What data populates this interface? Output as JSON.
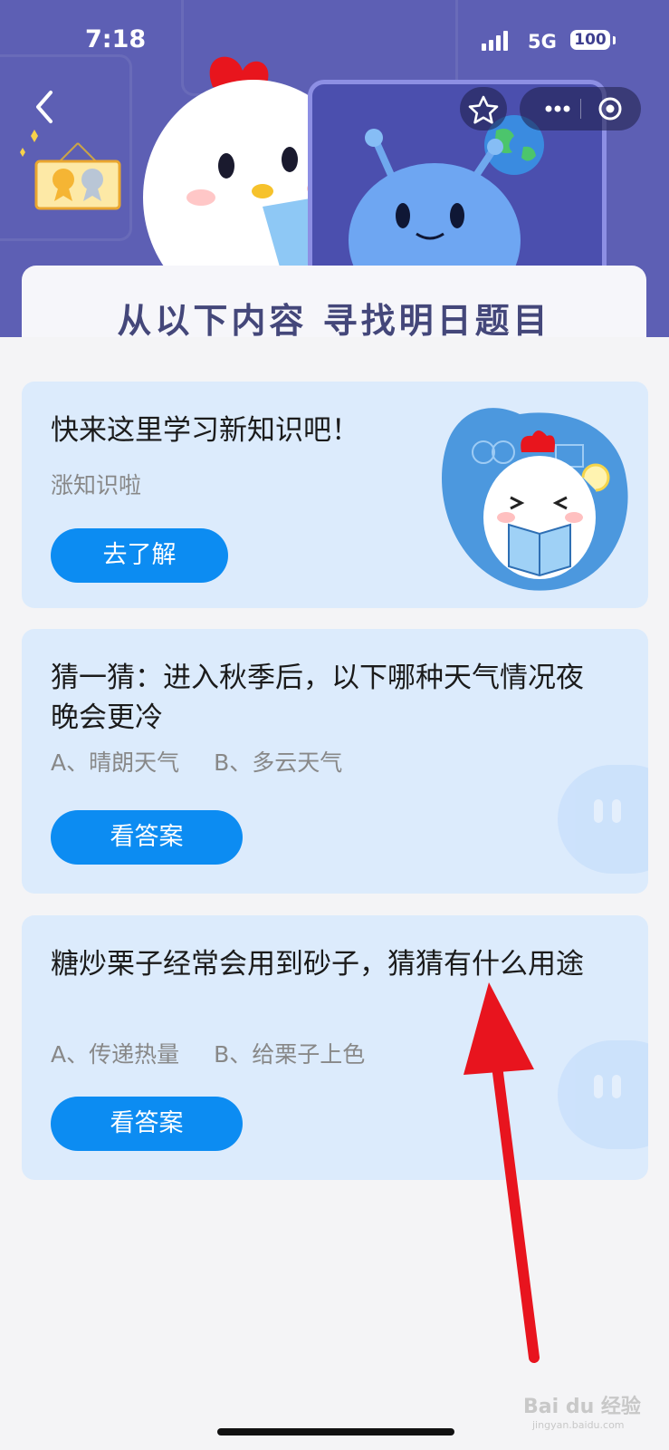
{
  "status": {
    "time": "7:18",
    "network": "5G",
    "battery": "100"
  },
  "header": {
    "title": "从以下内容 寻找明日题目"
  },
  "learn_card": {
    "title": "快来这里学习新知识吧！",
    "subtitle": "涨知识啦",
    "button": "去了解"
  },
  "questions": [
    {
      "text": "猜一猜：进入秋季后，以下哪种天气情况夜晚会更冷",
      "option_a": "A、晴朗天气",
      "option_b": "B、多云天气",
      "button": "看答案"
    },
    {
      "text": "糖炒栗子经常会用到砂子，猜猜有什么用途",
      "option_a": "A、传递热量",
      "option_b": "B、给栗子上色",
      "button": "看答案"
    }
  ],
  "watermark": {
    "brand": "Bai du 经验",
    "url": "jingyan.baidu.com"
  },
  "colors": {
    "header_bg": "#5d5fb4",
    "card_bg": "#dcebfc",
    "button": "#0c8cf2",
    "arrow": "#e8141e"
  }
}
